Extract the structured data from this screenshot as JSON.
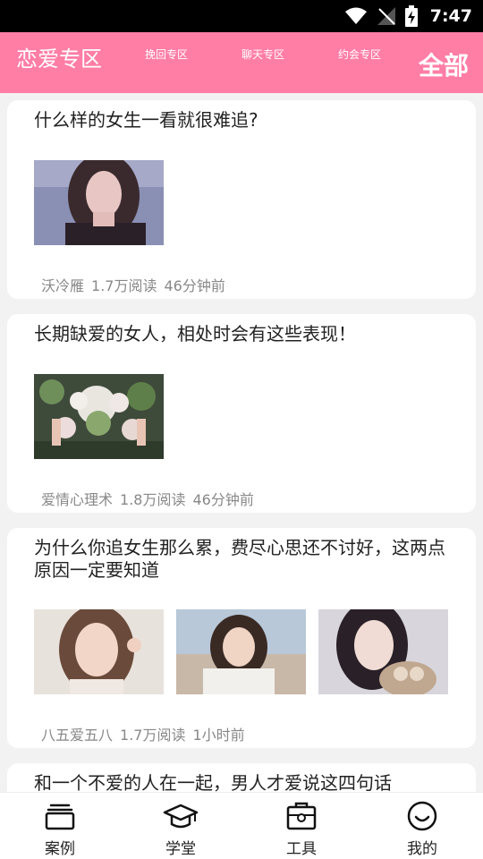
{
  "status_bar": {
    "time": "7:47"
  },
  "header": {
    "title": "恋爱专区",
    "tabs": [
      "挽回专区",
      "聊天专区",
      "约会专区"
    ],
    "all_label": "全部"
  },
  "articles": [
    {
      "title": "什么样的女生一看就很难追?",
      "author": "沃冷雁",
      "reads": "1.7万阅读",
      "time": "46分钟前"
    },
    {
      "title": "长期缺爱的女人，相处时会有这些表现！",
      "author": "爱情心理术",
      "reads": "1.8万阅读",
      "time": "46分钟前"
    },
    {
      "title": "为什么你追女生那么累，费尽心思还不讨好，这两点原因一定要知道",
      "author": "八五爱五八",
      "reads": "1.7万阅读",
      "time": "1小时前"
    },
    {
      "title": "和一个不爱的人在一起，男人才爱说这四句话"
    }
  ],
  "bottom_nav": [
    {
      "label": "案例",
      "icon": "cards-icon"
    },
    {
      "label": "学堂",
      "icon": "graduation-cap-icon"
    },
    {
      "label": "工具",
      "icon": "toolbox-icon"
    },
    {
      "label": "我的",
      "icon": "smiley-icon"
    }
  ]
}
